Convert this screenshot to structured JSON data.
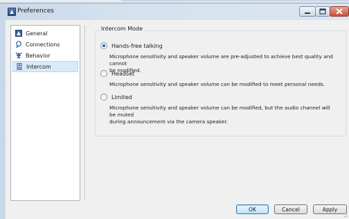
{
  "window": {
    "title": "Preferences",
    "controls": [
      "minimize-icon",
      "maximize-icon",
      "close-icon"
    ]
  },
  "sidebar": {
    "items": [
      {
        "label": "General",
        "icon": "general-icon",
        "selected": false
      },
      {
        "label": "Connections",
        "icon": "connections-icon",
        "selected": false
      },
      {
        "label": "Behavior",
        "icon": "behavior-icon",
        "selected": false
      },
      {
        "label": "Intercom",
        "icon": "intercom-icon",
        "selected": true
      }
    ]
  },
  "intercom": {
    "group_title": "Intercom Mode",
    "options": [
      {
        "label": "Hands-free talking",
        "checked": true,
        "description_line1": "Microphone sensitivity and speaker volume are pre-adjusted to achieve best quality and cannot",
        "description_line2": "be modified."
      },
      {
        "label": "Headset",
        "checked": false,
        "description_line1": "Microphone sensitivity and speaker volume can be modified to meet personal needs."
      },
      {
        "label": "Limited",
        "checked": false,
        "description_line1": "Microphone sensitivity and speaker volume can be modified, but the audio channel will be muted",
        "description_line2": "during announcement via the camera speaker."
      }
    ]
  },
  "buttons": {
    "ok": "OK",
    "cancel": "Cancel",
    "apply": "Apply"
  },
  "colors": {
    "selection_bg": "#d9ebf9",
    "radio_dot": "#2b5aa3",
    "close_button": "#c9503a"
  }
}
